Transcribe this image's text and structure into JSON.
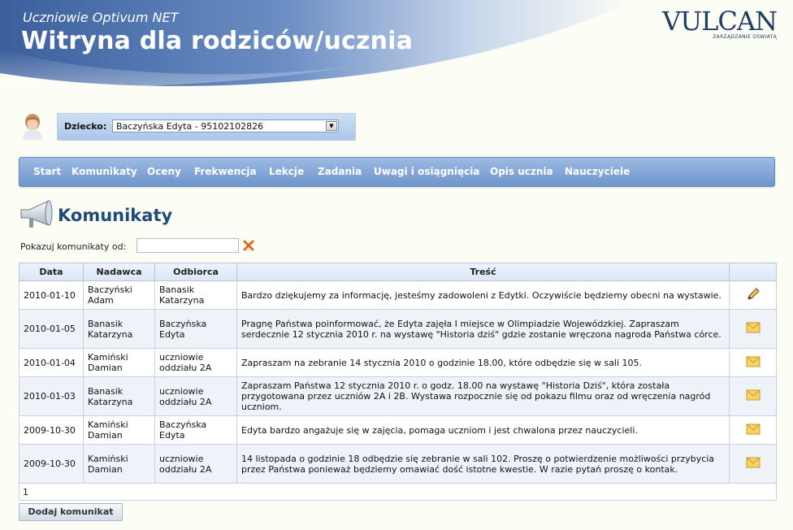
{
  "header": {
    "app_name": "Uczniowie Optivum NET",
    "title": "Witryna dla rodziców/ucznia",
    "logo_text": "VULCAN",
    "logo_subtext": "ZARZĄDZANIE OŚWIATĄ"
  },
  "child": {
    "label": "Dziecko:",
    "selected": "Baczyńska Edyta - 95102102826"
  },
  "nav": [
    "Start",
    "Komunikaty",
    "Oceny",
    "Frekwencja",
    "Lekcje",
    "Zadania",
    "Uwagi i osiągnięcia",
    "Opis ucznia",
    "Nauczyciele"
  ],
  "page": {
    "title": "Komunikaty",
    "filter_label": "Pokazuj komunikaty od:",
    "filter_value": ""
  },
  "table": {
    "headers": [
      "Data",
      "Nadawca",
      "Odbiorca",
      "Treść",
      ""
    ],
    "rows": [
      {
        "date": "2010-01-10",
        "sender": "Baczyński Adam",
        "recipient": "Banasik Katarzyna",
        "content": "Bardzo dziękujemy za informację, jesteśmy zadowoleni z Edytki. Oczywiście będziemy obecni na wystawie.",
        "icon": "pencil-icon"
      },
      {
        "date": "2010-01-05",
        "sender": "Banasik Katarzyna",
        "recipient": "Baczyńska Edyta",
        "content": "Pragnę Państwa poinformować, że Edyta zajęła I miejsce w Olimpiadzie Wojewódzkiej. Zapraszam serdecznie 12 stycznia 2010 r. na wystawę \"Historia dziś\" gdzie zostanie wręczona nagroda Państwa córce.",
        "icon": "envelope-icon"
      },
      {
        "date": "2010-01-04",
        "sender": "Kamiński Damian",
        "recipient": "uczniowie oddziału 2A",
        "content": "Zapraszam na zebranie 14 stycznia 2010 o godzinie 18.00, które odbędzie się w sali 105.",
        "icon": "envelope-icon"
      },
      {
        "date": "2010-01-03",
        "sender": "Banasik Katarzyna",
        "recipient": "uczniowie oddziału 2A",
        "content": "Zapraszam Państwa 12 stycznia 2010 r. o godz. 18.00 na wystawę \"Historia Dziś\", która została przygotowana przez uczniów 2A i 2B. Wystawa rozpocznie się od pokazu filmu oraz od wręczenia nagród uczniom.",
        "icon": "envelope-icon"
      },
      {
        "date": "2009-10-30",
        "sender": "Kamiński Damian",
        "recipient": "Baczyńska Edyta",
        "content": "Edyta bardzo angażuje się w zajęcia, pomaga uczniom i jest chwalona przez nauczycieli.",
        "icon": "envelope-icon"
      },
      {
        "date": "2009-10-30",
        "sender": "Kamiński Damian",
        "recipient": "uczniowie oddziału 2A",
        "content": "14 listopada o godzinie 18 odbędzie się zebranie w sali 102. Proszę o potwierdzenie możliwości przybycia przez Państwa ponieważ będziemy omawiać dość istotne kwestie. W razie pytań proszę o kontak.",
        "icon": "envelope-icon"
      }
    ],
    "pager": "1"
  },
  "add_button": "Dodaj komunikat",
  "colors": {
    "nav_bg": "#7fa2d6",
    "title": "#1f4a7a",
    "header_accent": "#4a6fa8"
  }
}
